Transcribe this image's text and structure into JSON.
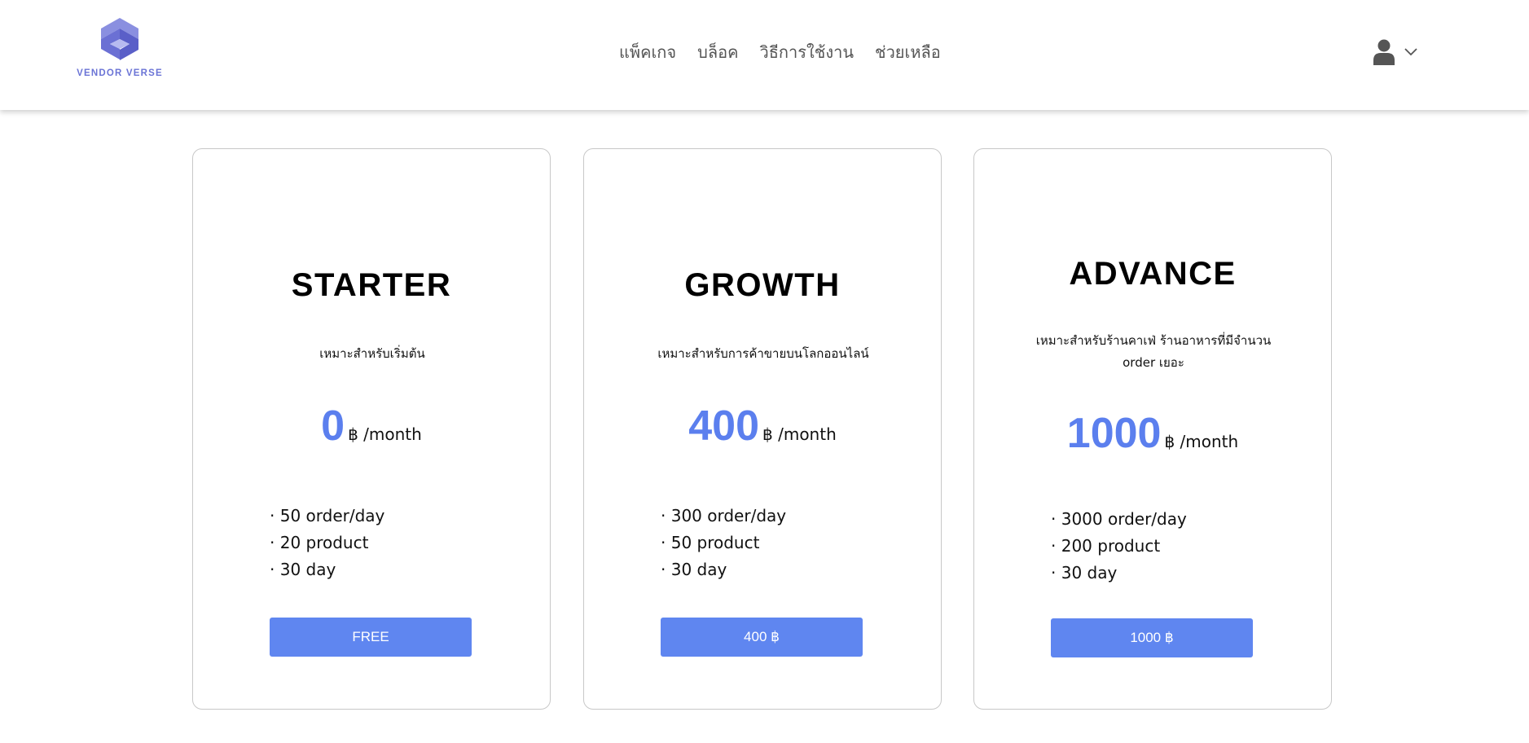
{
  "brand": {
    "name": "VENDOR VERSE",
    "accent": "#6b74d6"
  },
  "nav": [
    {
      "label": "แพ็คเกจ"
    },
    {
      "label": "บล็อค"
    },
    {
      "label": "วิธีการใช้งาน"
    },
    {
      "label": "ช่วยเหลือ"
    }
  ],
  "user_menu": {
    "icon": "user-icon",
    "chevron": "chevron-down-icon"
  },
  "price_color": "#5b7fee",
  "button_color": "#5f86f0",
  "plans": [
    {
      "name": "STARTER",
      "description": "เหมาะสำหรับเริ่มต้น",
      "price": "0",
      "price_unit": "฿ /month",
      "features": [
        "50 order/day",
        "20 product",
        "30 day"
      ],
      "button_label": "FREE"
    },
    {
      "name": "GROWTH",
      "description": "เหมาะสำหรับการค้าขายบนโลกออนไลน์",
      "price": "400",
      "price_unit": "฿ /month",
      "features": [
        "300 order/day",
        "50 product",
        "30 day"
      ],
      "button_label": "400 ฿"
    },
    {
      "name": "ADVANCE",
      "description": "เหมาะสำหรับร้านคาเฟ่ ร้านอาหารที่มีจำนวน order เยอะ",
      "price": "1000",
      "price_unit": "฿ /month",
      "features": [
        "3000 order/day",
        "200 product",
        "30 day"
      ],
      "button_label": "1000 ฿"
    }
  ]
}
